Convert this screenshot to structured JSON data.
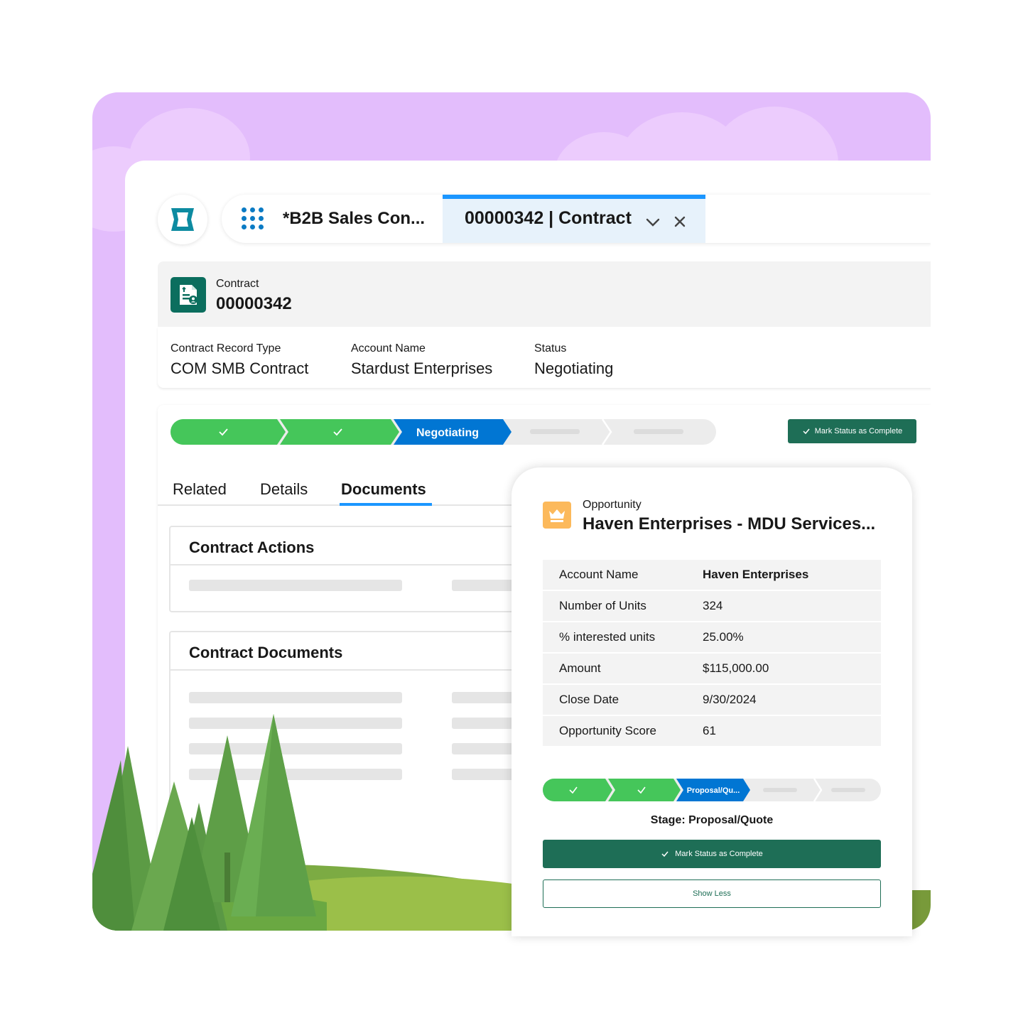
{
  "header": {
    "app_tab": "*B2B Sales Con...",
    "record_tab": "00000342 | Contract"
  },
  "record": {
    "object_label": "Contract",
    "name": "00000342",
    "fields": [
      {
        "label": "Contract Record Type",
        "value": "COM SMB Contract"
      },
      {
        "label": "Account Name",
        "value": "Stardust Enterprises"
      },
      {
        "label": "Status",
        "value": "Negotiating"
      }
    ]
  },
  "path": {
    "current_stage": "Negotiating",
    "mark_button": "Mark Status as Complete"
  },
  "tabs": [
    "Related",
    "Details",
    "Documents"
  ],
  "active_tab": "Documents",
  "cards": {
    "actions_title": "Contract Actions",
    "documents_title": "Contract Documents"
  },
  "opportunity": {
    "object_label": "Opportunity",
    "name": "Haven Enterprises - MDU Services...",
    "fields": [
      {
        "label": "Account Name",
        "value": "Haven Enterprises"
      },
      {
        "label": "Number of Units",
        "value": "324"
      },
      {
        "label": "% interested units",
        "value": "25.00%"
      },
      {
        "label": "Amount",
        "value": "$115,000.00"
      },
      {
        "label": "Close Date",
        "value": "9/30/2024"
      },
      {
        "label": "Opportunity Score",
        "value": "61"
      }
    ],
    "path_current": "Proposal/Qu...",
    "stage_text": "Stage: Proposal/Quote",
    "mark_button": "Mark Status as Complete",
    "show_less": "Show Less"
  },
  "colors": {
    "backdrop": "#e3bdfc",
    "brand_blue": "#0176d3",
    "complete_green": "#45c65a",
    "button_green": "#1e6e56",
    "contract_icon": "#0b6e5e",
    "opportunity_icon": "#fcb95b"
  },
  "icons": [
    "app-logo-icon",
    "app-launcher-icon",
    "chevron-down-icon",
    "close-icon",
    "contract-icon",
    "check-icon",
    "crown-icon",
    "tree-icon"
  ]
}
